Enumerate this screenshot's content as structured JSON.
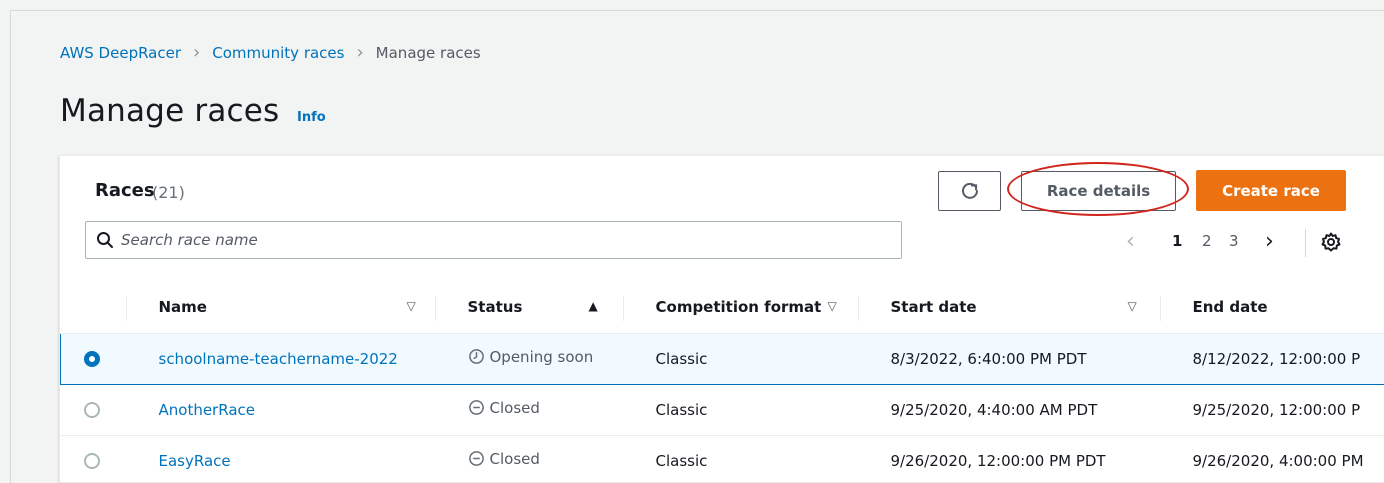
{
  "breadcrumb": {
    "items": [
      "AWS DeepRacer",
      "Community races",
      "Manage races"
    ]
  },
  "page": {
    "title": "Manage races",
    "info_link": "Info"
  },
  "races_panel": {
    "title": "Races",
    "count": "(21)",
    "refresh_icon": "refresh-icon",
    "details_button": "Race details",
    "create_button": "Create race",
    "search_placeholder": "Search race name",
    "pagination": {
      "prev": "‹",
      "pages": [
        "1",
        "2",
        "3"
      ],
      "current_page": "1",
      "next": "›"
    },
    "settings_icon": "gear-icon"
  },
  "table": {
    "columns": [
      "Name",
      "Status",
      "Competition format",
      "Start date",
      "End date"
    ],
    "rows": [
      {
        "selected": true,
        "name": "schoolname-teachername-2022",
        "status": "Opening soon",
        "status_icon": "clock-icon",
        "format": "Classic",
        "start": "8/3/2022, 6:40:00 PM PDT",
        "end": "8/12/2022, 12:00:00 P"
      },
      {
        "selected": false,
        "name": "AnotherRace",
        "status": "Closed",
        "status_icon": "minus-circle-icon",
        "format": "Classic",
        "start": "9/25/2020, 4:40:00 AM PDT",
        "end": "9/25/2020, 12:00:00 P"
      },
      {
        "selected": false,
        "name": "EasyRace",
        "status": "Closed",
        "status_icon": "minus-circle-icon",
        "format": "Classic",
        "start": "9/26/2020, 12:00:00 PM PDT",
        "end": "9/26/2020, 4:00:00 PM"
      }
    ]
  },
  "colors": {
    "link": "#0073bb",
    "primary_button": "#ec7211",
    "annotation_ring": "#d0251c",
    "selected_row_bg": "#f1faff"
  }
}
